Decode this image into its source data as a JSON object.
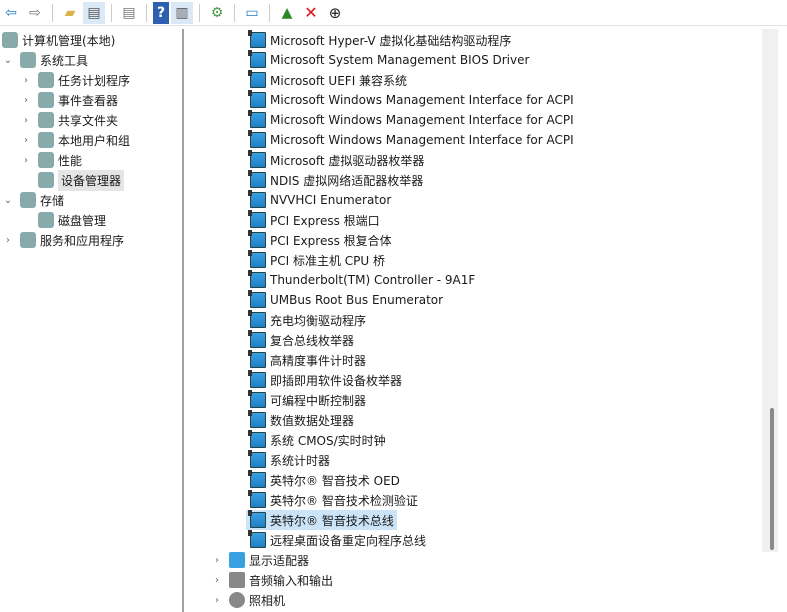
{
  "toolbar": {
    "buttons": [
      "back-icon",
      "forward-icon",
      "up-folder-icon",
      "show-hide-tree-icon",
      "properties-icon",
      "help-icon",
      "action-pane-icon",
      "update-driver-icon",
      "scan-hardware-icon",
      "enable-device-icon",
      "uninstall-icon",
      "disable-device-icon"
    ]
  },
  "tree": [
    {
      "label": "计算机管理(本地)",
      "level": 0,
      "icon": "computer-icon"
    },
    {
      "label": "系统工具",
      "level": 1,
      "expanded": true,
      "icon": "tools-icon"
    },
    {
      "label": "任务计划程序",
      "level": 2,
      "icon": "clock-icon"
    },
    {
      "label": "事件查看器",
      "level": 2,
      "icon": "event-viewer-icon"
    },
    {
      "label": "共享文件夹",
      "level": 2,
      "icon": "shared-folder-icon"
    },
    {
      "label": "本地用户和组",
      "level": 2,
      "icon": "users-icon"
    },
    {
      "label": "性能",
      "level": 2,
      "icon": "performance-icon"
    },
    {
      "label": "设备管理器",
      "level": 2,
      "icon": "device-manager-icon",
      "selected": true
    },
    {
      "label": "存储",
      "level": 1,
      "expanded": true,
      "icon": "storage-icon"
    },
    {
      "label": "磁盘管理",
      "level": 2,
      "icon": "disk-icon"
    },
    {
      "label": "服务和应用程序",
      "level": 1,
      "icon": "services-icon"
    }
  ],
  "devices": [
    "Microsoft Hyper-V 虚拟化基础结构驱动程序",
    "Microsoft System Management BIOS Driver",
    "Microsoft UEFI 兼容系统",
    "Microsoft Windows Management Interface for ACPI",
    "Microsoft Windows Management Interface for ACPI",
    "Microsoft Windows Management Interface for ACPI",
    "Microsoft 虚拟驱动器枚举器",
    "NDIS 虚拟网络适配器枚举器",
    "NVVHCI Enumerator",
    "PCI Express 根端口",
    "PCI Express 根复合体",
    "PCI 标准主机 CPU 桥",
    "Thunderbolt(TM) Controller - 9A1F",
    "UMBus Root Bus Enumerator",
    "充电均衡驱动程序",
    "复合总线枚举器",
    "高精度事件计时器",
    "即插即用软件设备枚举器",
    "可编程中断控制器",
    "数值数据处理器",
    "系统 CMOS/实时时钟",
    "系统计时器",
    "英特尔® 智音技术 OED",
    "英特尔® 智音技术检测验证",
    "英特尔® 智音技术总线",
    "远程桌面设备重定向程序总线"
  ],
  "selected_device": 24,
  "categories": [
    {
      "label": "显示适配器",
      "icon": "display-adapter-icon"
    },
    {
      "label": "音频输入和输出",
      "icon": "speaker-icon"
    },
    {
      "label": "照相机",
      "icon": "camera-icon"
    }
  ],
  "scroll_position_fraction": 0.73
}
